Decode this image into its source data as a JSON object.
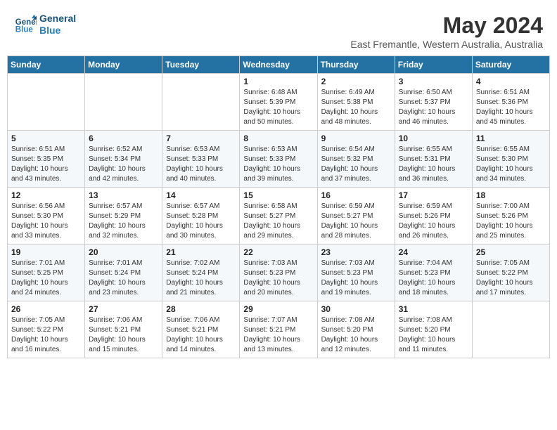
{
  "header": {
    "logo_line1": "General",
    "logo_line2": "Blue",
    "month": "May 2024",
    "location": "East Fremantle, Western Australia, Australia"
  },
  "weekdays": [
    "Sunday",
    "Monday",
    "Tuesday",
    "Wednesday",
    "Thursday",
    "Friday",
    "Saturday"
  ],
  "weeks": [
    [
      {
        "day": "",
        "info": ""
      },
      {
        "day": "",
        "info": ""
      },
      {
        "day": "",
        "info": ""
      },
      {
        "day": "1",
        "info": "Sunrise: 6:48 AM\nSunset: 5:39 PM\nDaylight: 10 hours\nand 50 minutes."
      },
      {
        "day": "2",
        "info": "Sunrise: 6:49 AM\nSunset: 5:38 PM\nDaylight: 10 hours\nand 48 minutes."
      },
      {
        "day": "3",
        "info": "Sunrise: 6:50 AM\nSunset: 5:37 PM\nDaylight: 10 hours\nand 46 minutes."
      },
      {
        "day": "4",
        "info": "Sunrise: 6:51 AM\nSunset: 5:36 PM\nDaylight: 10 hours\nand 45 minutes."
      }
    ],
    [
      {
        "day": "5",
        "info": "Sunrise: 6:51 AM\nSunset: 5:35 PM\nDaylight: 10 hours\nand 43 minutes."
      },
      {
        "day": "6",
        "info": "Sunrise: 6:52 AM\nSunset: 5:34 PM\nDaylight: 10 hours\nand 42 minutes."
      },
      {
        "day": "7",
        "info": "Sunrise: 6:53 AM\nSunset: 5:33 PM\nDaylight: 10 hours\nand 40 minutes."
      },
      {
        "day": "8",
        "info": "Sunrise: 6:53 AM\nSunset: 5:33 PM\nDaylight: 10 hours\nand 39 minutes."
      },
      {
        "day": "9",
        "info": "Sunrise: 6:54 AM\nSunset: 5:32 PM\nDaylight: 10 hours\nand 37 minutes."
      },
      {
        "day": "10",
        "info": "Sunrise: 6:55 AM\nSunset: 5:31 PM\nDaylight: 10 hours\nand 36 minutes."
      },
      {
        "day": "11",
        "info": "Sunrise: 6:55 AM\nSunset: 5:30 PM\nDaylight: 10 hours\nand 34 minutes."
      }
    ],
    [
      {
        "day": "12",
        "info": "Sunrise: 6:56 AM\nSunset: 5:30 PM\nDaylight: 10 hours\nand 33 minutes."
      },
      {
        "day": "13",
        "info": "Sunrise: 6:57 AM\nSunset: 5:29 PM\nDaylight: 10 hours\nand 32 minutes."
      },
      {
        "day": "14",
        "info": "Sunrise: 6:57 AM\nSunset: 5:28 PM\nDaylight: 10 hours\nand 30 minutes."
      },
      {
        "day": "15",
        "info": "Sunrise: 6:58 AM\nSunset: 5:27 PM\nDaylight: 10 hours\nand 29 minutes."
      },
      {
        "day": "16",
        "info": "Sunrise: 6:59 AM\nSunset: 5:27 PM\nDaylight: 10 hours\nand 28 minutes."
      },
      {
        "day": "17",
        "info": "Sunrise: 6:59 AM\nSunset: 5:26 PM\nDaylight: 10 hours\nand 26 minutes."
      },
      {
        "day": "18",
        "info": "Sunrise: 7:00 AM\nSunset: 5:26 PM\nDaylight: 10 hours\nand 25 minutes."
      }
    ],
    [
      {
        "day": "19",
        "info": "Sunrise: 7:01 AM\nSunset: 5:25 PM\nDaylight: 10 hours\nand 24 minutes."
      },
      {
        "day": "20",
        "info": "Sunrise: 7:01 AM\nSunset: 5:24 PM\nDaylight: 10 hours\nand 23 minutes."
      },
      {
        "day": "21",
        "info": "Sunrise: 7:02 AM\nSunset: 5:24 PM\nDaylight: 10 hours\nand 21 minutes."
      },
      {
        "day": "22",
        "info": "Sunrise: 7:03 AM\nSunset: 5:23 PM\nDaylight: 10 hours\nand 20 minutes."
      },
      {
        "day": "23",
        "info": "Sunrise: 7:03 AM\nSunset: 5:23 PM\nDaylight: 10 hours\nand 19 minutes."
      },
      {
        "day": "24",
        "info": "Sunrise: 7:04 AM\nSunset: 5:23 PM\nDaylight: 10 hours\nand 18 minutes."
      },
      {
        "day": "25",
        "info": "Sunrise: 7:05 AM\nSunset: 5:22 PM\nDaylight: 10 hours\nand 17 minutes."
      }
    ],
    [
      {
        "day": "26",
        "info": "Sunrise: 7:05 AM\nSunset: 5:22 PM\nDaylight: 10 hours\nand 16 minutes."
      },
      {
        "day": "27",
        "info": "Sunrise: 7:06 AM\nSunset: 5:21 PM\nDaylight: 10 hours\nand 15 minutes."
      },
      {
        "day": "28",
        "info": "Sunrise: 7:06 AM\nSunset: 5:21 PM\nDaylight: 10 hours\nand 14 minutes."
      },
      {
        "day": "29",
        "info": "Sunrise: 7:07 AM\nSunset: 5:21 PM\nDaylight: 10 hours\nand 13 minutes."
      },
      {
        "day": "30",
        "info": "Sunrise: 7:08 AM\nSunset: 5:20 PM\nDaylight: 10 hours\nand 12 minutes."
      },
      {
        "day": "31",
        "info": "Sunrise: 7:08 AM\nSunset: 5:20 PM\nDaylight: 10 hours\nand 11 minutes."
      },
      {
        "day": "",
        "info": ""
      }
    ]
  ]
}
